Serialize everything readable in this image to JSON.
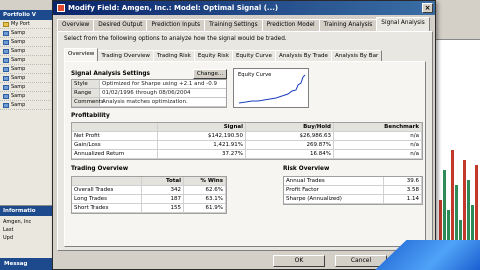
{
  "background": {
    "portfolio_header": "Portfolio V",
    "tree_items": [
      "My Port",
      "Samp",
      "Samp",
      "Samp",
      "Samp",
      "Samp",
      "Samp",
      "Samp",
      "Samp",
      "Samp"
    ],
    "info_header": "Informatio",
    "info_lines": [
      "Amgen, Inc",
      "Last",
      "Upd"
    ],
    "messages_label": "Messag",
    "chart_years": [
      "03",
      "2004"
    ]
  },
  "dialog": {
    "title": "Modify Field: Amgen, Inc.: Model: Optimal Signal (...)",
    "main_tabs": [
      "Overview",
      "Desired Output",
      "Prediction Inputs",
      "Training Settings",
      "Prediction Model",
      "Training Analysis",
      "Signal Analysis"
    ],
    "active_main_tab": "Signal Analysis",
    "instruction": "Select from the following options to analyze how the signal would be traded.",
    "sub_tabs": [
      "Overview",
      "Trading Overview",
      "Trading Risk",
      "Equity Risk",
      "Equity Curve",
      "Analysis By Trade",
      "Analysis By Bar"
    ],
    "active_sub_tab": "Overview",
    "settings": {
      "title": "Signal Analysis Settings",
      "change_label": "Change...",
      "rows": [
        {
          "key": "Style",
          "value": "Optimized for Sharpe using +2.1 and -0.9"
        },
        {
          "key": "Range",
          "value": "01/02/1996 through 08/06/2004"
        },
        {
          "key": "Comments",
          "value": "Analysis matches optimization."
        }
      ]
    },
    "equity_curve_label": "Equity Curve",
    "profitability": {
      "title": "Profitability",
      "columns": [
        "",
        "Signal",
        "Buy/Hold",
        "Benchmark"
      ],
      "rows": [
        [
          "Net Profit",
          "$142,190.50",
          "$26,986.63",
          "n/a"
        ],
        [
          "Gain/Loss",
          "1,421.91%",
          "269.87%",
          "n/a"
        ],
        [
          "Annualized Return",
          "37.27%",
          "16.84%",
          "n/a"
        ]
      ]
    },
    "trading": {
      "title": "Trading Overview",
      "columns": [
        "",
        "Total",
        "% Wins"
      ],
      "rows": [
        [
          "Overall Trades",
          "342",
          "62.6%"
        ],
        [
          "Long Trades",
          "187",
          "63.1%"
        ],
        [
          "Short Trades",
          "155",
          "61.9%"
        ]
      ]
    },
    "risk": {
      "title": "Risk Overview",
      "rows": [
        [
          "Annual Trades",
          "39.6"
        ],
        [
          "Profit Factor",
          "3.58"
        ],
        [
          "Sharpe (Annualized)",
          "1.14"
        ]
      ]
    },
    "ok_label": "OK",
    "cancel_label": "Cancel"
  }
}
